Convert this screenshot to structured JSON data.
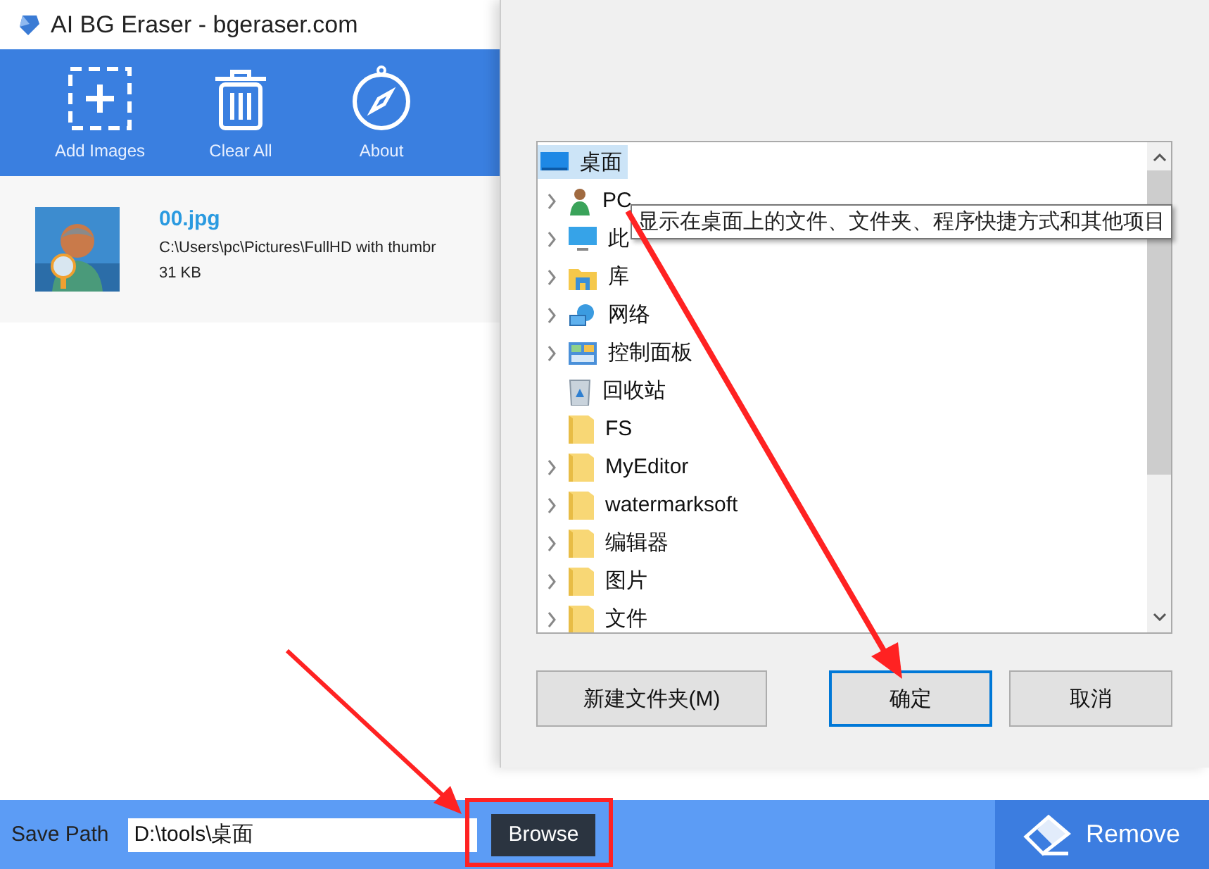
{
  "app": {
    "title": "AI BG Eraser - bgeraser.com",
    "toolbar": [
      {
        "kind": "add",
        "label": "Add Images"
      },
      {
        "kind": "clear",
        "label": "Clear All"
      },
      {
        "kind": "about",
        "label": "About"
      }
    ],
    "files": [
      {
        "name": "00.jpg",
        "path": "C:\\Users\\pc\\Pictures\\FullHD with thumbr",
        "size": "31 KB"
      }
    ]
  },
  "dialog": {
    "tree": [
      {
        "label": "桌面",
        "kind": "desktop",
        "expandable": false,
        "selected": true
      },
      {
        "label": "PC",
        "kind": "user",
        "expandable": true,
        "selected": false
      },
      {
        "label": "此",
        "kind": "computer",
        "expandable": true,
        "selected": false
      },
      {
        "label": "库",
        "kind": "library",
        "expandable": true,
        "selected": false
      },
      {
        "label": "网络",
        "kind": "network",
        "expandable": true,
        "selected": false
      },
      {
        "label": "控制面板",
        "kind": "control-panel",
        "expandable": true,
        "selected": false
      },
      {
        "label": "回收站",
        "kind": "recycle",
        "expandable": false,
        "selected": false
      },
      {
        "label": "FS",
        "kind": "folder",
        "expandable": false,
        "selected": false
      },
      {
        "label": "MyEditor",
        "kind": "folder",
        "expandable": true,
        "selected": false
      },
      {
        "label": "watermarksoft",
        "kind": "folder",
        "expandable": true,
        "selected": false
      },
      {
        "label": "编辑器",
        "kind": "folder",
        "expandable": true,
        "selected": false
      },
      {
        "label": "图片",
        "kind": "folder",
        "expandable": true,
        "selected": false
      },
      {
        "label": "文件",
        "kind": "folder",
        "expandable": true,
        "selected": false
      }
    ],
    "tooltip": "显示在桌面上的文件、文件夹、程序快捷方式和其他项目",
    "buttons": [
      {
        "label": "新建文件夹(M)",
        "focused": false
      },
      {
        "label": "确定",
        "focused": true
      },
      {
        "label": "取消",
        "focused": false
      }
    ]
  },
  "bottom_bar": {
    "label": "Save Path",
    "value": "D:\\tools\\桌面",
    "browse": "Browse",
    "remove": "Remove"
  }
}
